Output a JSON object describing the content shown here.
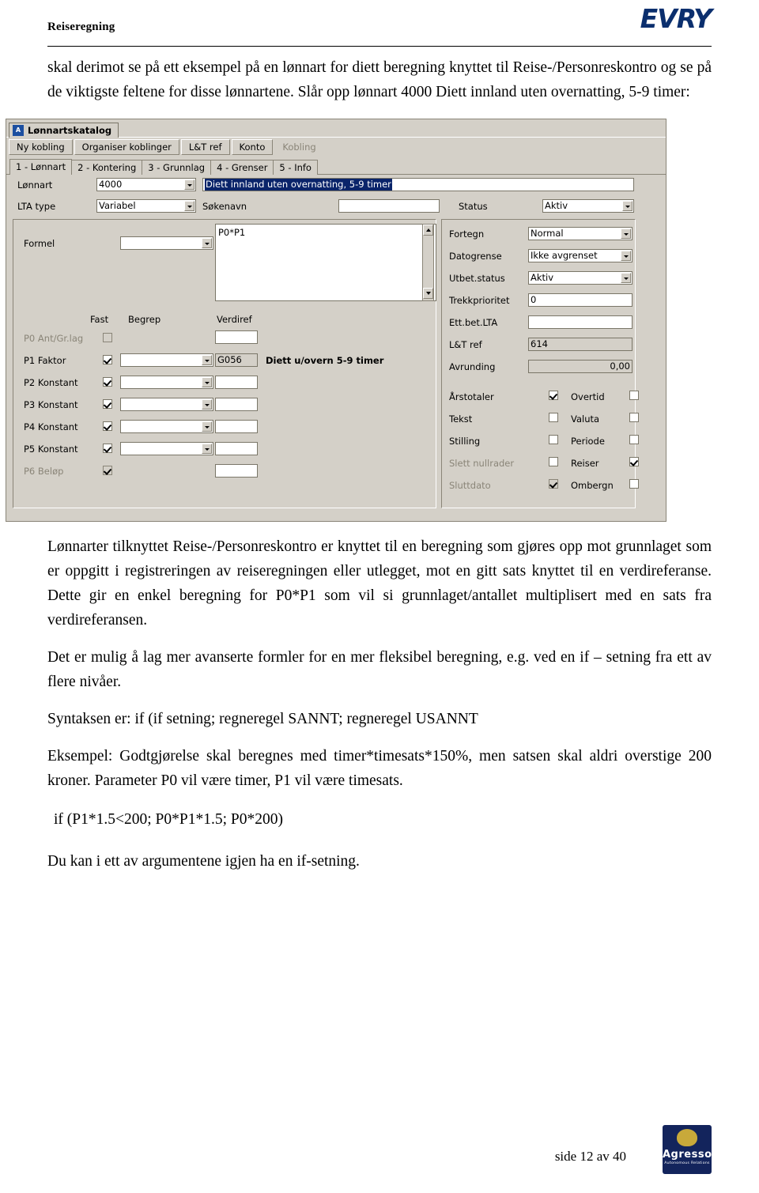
{
  "header": {
    "title": "Reiseregning",
    "logo_text": "EVRY"
  },
  "paragraphs": {
    "p1": "skal derimot se på ett eksempel på en lønnart for diett beregning knyttet til Reise-/Personreskontro og se på de viktigste feltene for disse lønnartene.  Slår opp lønnart 4000 Diett innland uten overnatting, 5-9 timer:",
    "p2": "Lønnarter tilknyttet Reise-/Personreskontro er knyttet til en beregning som gjøres opp mot grunnlaget som er oppgitt i registreringen av reiseregningen eller utlegget, mot en gitt sats knyttet til en verdireferanse. Dette gir en enkel beregning for P0*P1 som vil si grunnlaget/antallet multiplisert med en sats fra verdireferansen.",
    "p3": "Det er mulig å lag mer avanserte formler for en mer fleksibel beregning, e.g. ved en if – setning fra ett av flere nivåer.",
    "p4": "Syntaksen er: if (if setning; regneregel SANNT; regneregel USANNT",
    "p5": "Eksempel: Godtgjørelse skal beregnes med timer*timesats*150%, men satsen skal aldri overstige 200 kroner. Parameter P0 vil være timer, P1 vil være timesats.",
    "code": "if (P1*1.5<200; P0*P1*1.5; P0*200)",
    "p6": "Du kan i ett av argumentene igjen ha en if-setning."
  },
  "screenshot": {
    "window_title": "Lønnartskatalog",
    "toolbar": [
      {
        "label": "Ny kobling",
        "disabled": false
      },
      {
        "label": "Organiser koblinger",
        "disabled": false
      },
      {
        "label": "L&T ref",
        "disabled": false
      },
      {
        "label": "Konto",
        "disabled": false
      },
      {
        "label": "Kobling",
        "disabled": true
      }
    ],
    "tabs": [
      {
        "label": "1 - Lønnart",
        "active": true
      },
      {
        "label": "2 - Kontering",
        "active": false
      },
      {
        "label": "3 - Grunnlag",
        "active": false
      },
      {
        "label": "4 - Grenser",
        "active": false
      },
      {
        "label": "5 - Info",
        "active": false
      }
    ],
    "top_fields": {
      "lonnart_label": "Lønnart",
      "lonnart_value": "4000",
      "lonnart_desc": "Diett innland uten overnatting, 5-9 timer",
      "lta_type_label": "LTA type",
      "lta_type_value": "Variabel",
      "sokenavn_label": "Søkenavn",
      "sokenavn_value": "",
      "status_label": "Status",
      "status_value": "Aktiv"
    },
    "formula": {
      "label": "Formel",
      "combo_value": "",
      "text_area_value": "P0*P1"
    },
    "param_headers": {
      "fast": "Fast",
      "begrep": "Begrep",
      "verdiref": "Verdiref"
    },
    "params": [
      {
        "label": "P0 Ant/Gr.lag",
        "checked": false,
        "dim": true,
        "begrep": "",
        "has_combo": false,
        "verdiref": "",
        "desc": ""
      },
      {
        "label": "P1 Faktor",
        "checked": true,
        "dim": false,
        "begrep": "",
        "has_combo": true,
        "verdiref": "G056",
        "desc": "Diett u/overn 5-9 timer"
      },
      {
        "label": "P2 Konstant",
        "checked": true,
        "dim": false,
        "begrep": "",
        "has_combo": true,
        "verdiref": "",
        "desc": ""
      },
      {
        "label": "P3 Konstant",
        "checked": true,
        "dim": false,
        "begrep": "",
        "has_combo": true,
        "verdiref": "",
        "desc": ""
      },
      {
        "label": "P4 Konstant",
        "checked": true,
        "dim": false,
        "begrep": "",
        "has_combo": true,
        "verdiref": "",
        "desc": ""
      },
      {
        "label": "P5 Konstant",
        "checked": true,
        "dim": false,
        "begrep": "",
        "has_combo": true,
        "verdiref": "",
        "desc": ""
      },
      {
        "label": "P6 Beløp",
        "checked": true,
        "dim": true,
        "begrep": "",
        "has_combo": false,
        "verdiref": "",
        "desc": ""
      }
    ],
    "right_fields": [
      {
        "label": "Fortegn",
        "value": "Normal",
        "type": "combo"
      },
      {
        "label": "Datogrense",
        "value": "Ikke avgrenset",
        "type": "combo"
      },
      {
        "label": "Utbet.status",
        "value": "Aktiv",
        "type": "combo"
      },
      {
        "label": "Trekkprioritet",
        "value": "0",
        "type": "text"
      },
      {
        "label": "Ett.bet.LTA",
        "value": "",
        "type": "text"
      },
      {
        "label": "L&T ref",
        "value": "614",
        "type": "text"
      },
      {
        "label": "Avrunding",
        "value": "0,00",
        "type": "text-right"
      }
    ],
    "right_checks": [
      {
        "left_label": "Årstotaler",
        "left_checked": true,
        "left_dim": false,
        "right_label": "Overtid",
        "right_checked": false,
        "right_dim": false
      },
      {
        "left_label": "Tekst",
        "left_checked": false,
        "left_dim": false,
        "right_label": "Valuta",
        "right_checked": false,
        "right_dim": false
      },
      {
        "left_label": "Stilling",
        "left_checked": false,
        "left_dim": false,
        "right_label": "Periode",
        "right_checked": false,
        "right_dim": false
      },
      {
        "left_label": "Slett nullrader",
        "left_checked": false,
        "left_dim": true,
        "right_label": "Reiser",
        "right_checked": true,
        "right_dim": false
      },
      {
        "left_label": "Sluttdato",
        "left_checked": true,
        "left_dim": true,
        "right_label": "Ombergn",
        "right_checked": false,
        "right_dim": false
      }
    ]
  },
  "footer": {
    "page_label": "side 12 av 40",
    "logo_name": "Agresso",
    "logo_sub": "Autonomous Relations"
  }
}
